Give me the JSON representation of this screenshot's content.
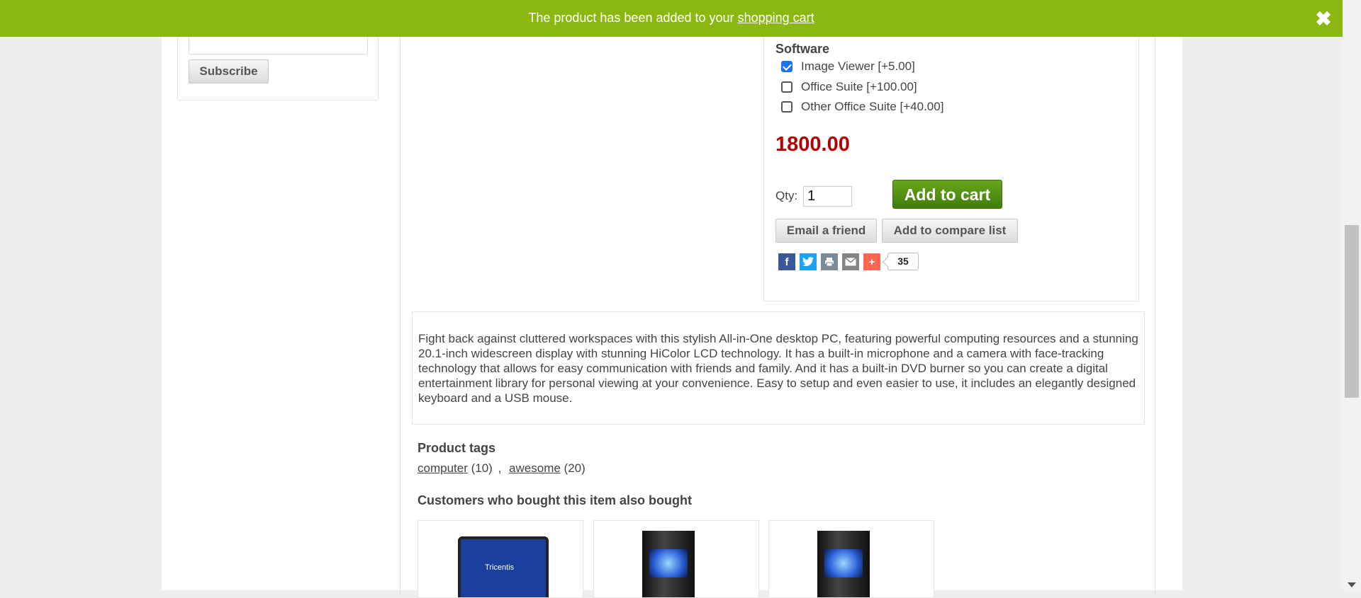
{
  "notification": {
    "text": "The product has been added to your ",
    "link": "shopping cart"
  },
  "sidebar": {
    "subscribe_label": "Subscribe"
  },
  "product": {
    "software_label": "Software",
    "options": [
      {
        "label": "Image Viewer [+5.00]",
        "checked": true
      },
      {
        "label": "Office Suite [+100.00]",
        "checked": false
      },
      {
        "label": "Other Office Suite [+40.00]",
        "checked": false
      }
    ],
    "price": "1800.00",
    "qty_label": "Qty:",
    "qty_value": "1",
    "add_to_cart": "Add to cart",
    "email_friend": "Email a friend",
    "compare": "Add to compare list",
    "share_count": "35",
    "description": "Fight back against cluttered workspaces with this stylish All-in-One desktop PC, featuring powerful computing resources and a stunning 20.1-inch widescreen display with stunning HiColor LCD technology. It has a built-in microphone and a camera with face-tracking technology that allows for easy communication with friends and family. And it has a built-in DVD burner so you can create a digital entertainment library for personal viewing at your convenience. Easy to setup and even easier to use, it includes an elegantly designed keyboard and a USB mouse."
  },
  "tags": {
    "title": "Product tags",
    "items": [
      {
        "name": "computer",
        "count": "(10)"
      },
      {
        "name": "awesome",
        "count": "(20)"
      }
    ],
    "separator": ","
  },
  "also_bought": {
    "title": "Customers who bought this item also bought",
    "tablet_brand": "Tricentis"
  },
  "colors": {
    "notify_bg": "#8ab810",
    "price": "#b30000",
    "cart_button": "#4e8f14"
  }
}
